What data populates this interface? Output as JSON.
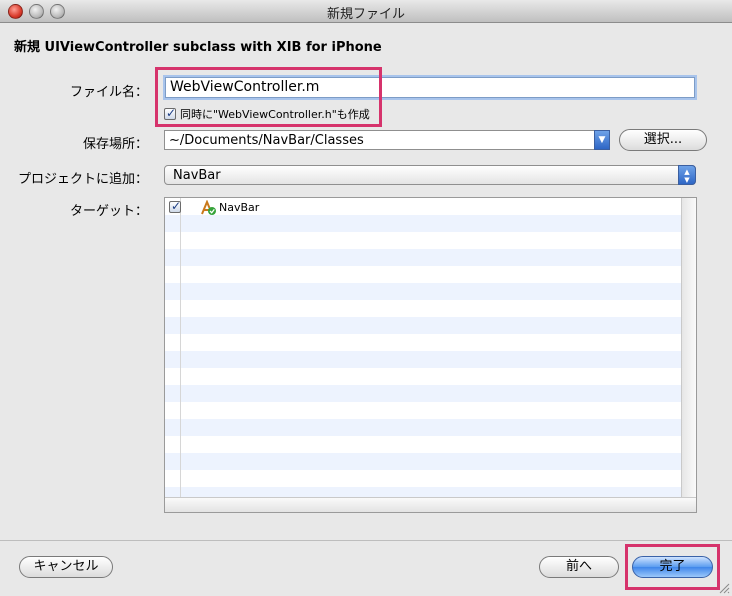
{
  "window": {
    "title": "新規ファイル"
  },
  "heading": "新規 UIViewController subclass with XIB for iPhone",
  "form": {
    "filename_label": "ファイル名：",
    "filename_value": "WebViewController.m",
    "also_create_label": "同時に\"WebViewController.h\"も作成",
    "also_create_checked": true,
    "location_label": "保存場所：",
    "location_value": "~/Documents/NavBar/Classes",
    "choose_button": "選択...",
    "add_to_project_label": "プロジェクトに追加：",
    "add_to_project_value": "NavBar",
    "targets_label": "ターゲット：",
    "targets": [
      {
        "name": "NavBar",
        "checked": true,
        "icon": "app-target-icon"
      }
    ]
  },
  "footer": {
    "cancel_button": "キャンセル",
    "previous_button": "前へ",
    "finish_button": "完了"
  },
  "colors": {
    "highlight": "#d6336c",
    "accent_blue": "#3f86ea",
    "stripe": "#edf3fe"
  }
}
